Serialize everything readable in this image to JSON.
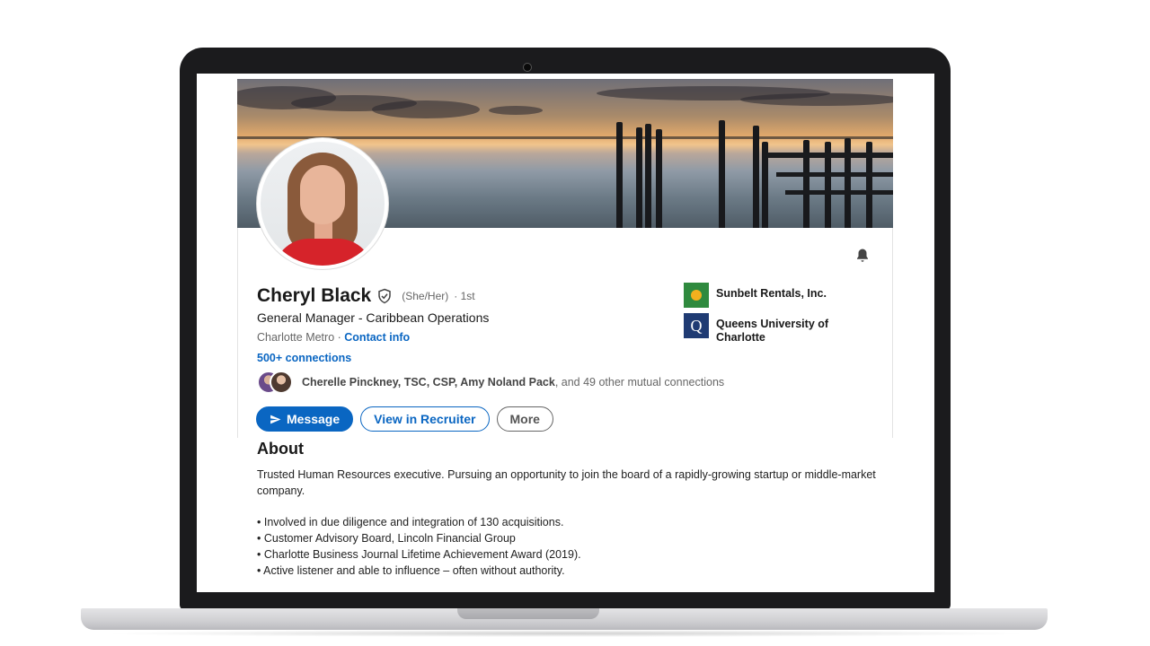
{
  "profile": {
    "name": "Cheryl Black",
    "pronouns": "(She/Her)",
    "degree": "· 1st",
    "headline": "General Manager - Caribbean Operations",
    "location": "Charlotte Metro",
    "location_separator": " · ",
    "contact_info": "Contact info",
    "connections": "500+ connections",
    "mutual": {
      "names": "Cherelle Pinckney, TSC, CSP, Amy Noland Pack",
      "rest": ", and 49 other mutual connections"
    }
  },
  "actions": {
    "message": "Message",
    "recruiter": "View in Recruiter",
    "more": "More"
  },
  "companies": [
    {
      "name": "Sunbelt Rentals, Inc."
    },
    {
      "name": "Queens University of Charlotte",
      "logo_letter": "Q"
    }
  ],
  "about": {
    "title": "About",
    "summary": "Trusted Human Resources executive. Pursuing an opportunity to join the board of a rapidly-growing startup or middle-market company.",
    "bullets": [
      "Involved in due diligence and integration of 130 acquisitions.",
      "Customer Advisory Board, Lincoln Financial Group",
      "Charlotte Business Journal Lifetime Achievement Award (2019).",
      "Active listener and able to influence – often without authority."
    ]
  },
  "colors": {
    "accent": "#0a66c2",
    "laptop_bezel": "#1b1b1d"
  },
  "icons": {
    "verified": "shield-check-icon",
    "bell": "bell-icon",
    "send": "paper-plane-icon"
  }
}
